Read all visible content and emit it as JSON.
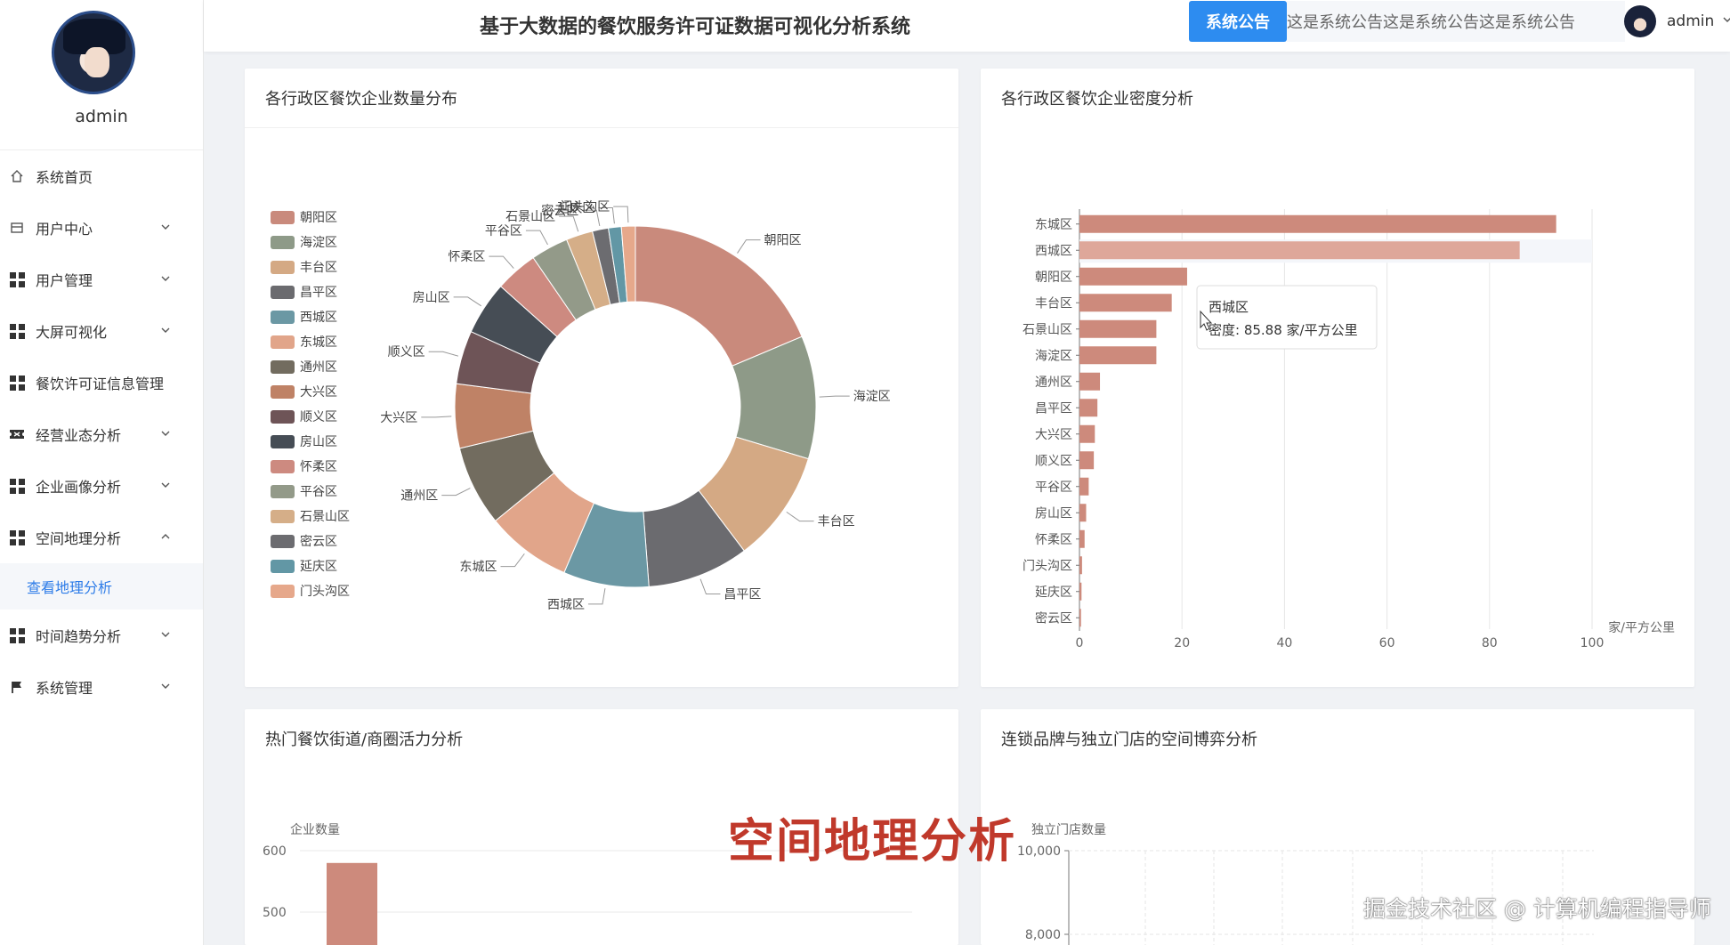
{
  "header": {
    "title": "基于大数据的餐饮服务许可证数据可视化分析系统",
    "notice_button": "系统公告",
    "notice_text": "这是系统公告这是系统公告这是系统公告",
    "user": "admin"
  },
  "sidebar": {
    "username": "admin",
    "items": [
      {
        "label": "系统首页",
        "icon": "home-icon"
      },
      {
        "label": "用户中心",
        "icon": "user-center-icon"
      },
      {
        "label": "用户管理",
        "icon": "grid-icon"
      },
      {
        "label": "大屏可视化",
        "icon": "grid-icon"
      },
      {
        "label": "餐饮许可证信息管理",
        "icon": "grid-icon"
      },
      {
        "label": "经营业态分析",
        "icon": "ticket-icon"
      },
      {
        "label": "企业画像分析",
        "icon": "grid-icon"
      },
      {
        "label": "空间地理分析",
        "icon": "grid-icon"
      },
      {
        "label": "时间趋势分析",
        "icon": "grid-icon"
      },
      {
        "label": "系统管理",
        "icon": "flag-icon"
      }
    ],
    "active_sub": "查看地理分析"
  },
  "cards": {
    "donut_title": "各行政区餐饮企业数量分布",
    "density_title": "各行政区餐饮企业密度分析",
    "street_title": "热门餐饮街道/商圈活力分析",
    "chain_title": "连锁品牌与独立门店的空间博弈分析"
  },
  "overlay": {
    "title": "空间地理分析",
    "watermark": "掘金技术社区 @ 计算机编程指导师"
  },
  "chart_data": [
    {
      "type": "pie",
      "title": "各行政区餐饮企业数量分布",
      "legend_position": "left",
      "categories": [
        "朝阳区",
        "海淀区",
        "丰台区",
        "昌平区",
        "西城区",
        "东城区",
        "通州区",
        "大兴区",
        "顺义区",
        "房山区",
        "怀柔区",
        "平谷区",
        "石景山区",
        "密云区",
        "延庆区",
        "门头沟区"
      ],
      "values": [
        19.5,
        11.5,
        10.5,
        9.5,
        8,
        8,
        7.5,
        6,
        5,
        5,
        4,
        3.5,
        2.5,
        1.5,
        1.2,
        1.3
      ],
      "colors": [
        "#c98a7c",
        "#8e9a88",
        "#d4a984",
        "#6b6b6f",
        "#6b98a4",
        "#e1a58a",
        "#726c5f",
        "#bf8266",
        "#6e5457",
        "#464d55",
        "#cd8a80",
        "#939a89",
        "#d5ae88",
        "#6c6c70",
        "#6297a5",
        "#e6a88b"
      ]
    },
    {
      "type": "bar",
      "title": "各行政区餐饮企业密度分析",
      "orientation": "horizontal",
      "categories": [
        "东城区",
        "西城区",
        "朝阳区",
        "丰台区",
        "石景山区",
        "海淀区",
        "通州区",
        "昌平区",
        "大兴区",
        "顺义区",
        "平谷区",
        "房山区",
        "怀柔区",
        "门头沟区",
        "延庆区",
        "密云区"
      ],
      "values": [
        93,
        85.88,
        21,
        18,
        15,
        15,
        4,
        3.5,
        3,
        2.8,
        1.8,
        1.3,
        1,
        0.5,
        0.4,
        0.3
      ],
      "xlabel": "家/平方公里",
      "xlim": [
        0,
        100
      ],
      "xticks": [
        0,
        20,
        40,
        60,
        80,
        100
      ],
      "tooltip": {
        "title": "西城区",
        "text": "密度: 85.88 家/平方公里"
      }
    },
    {
      "type": "bar",
      "title": "热门餐饮街道/商圈活力分析",
      "ylabel": "企业数量",
      "yticks": [
        600,
        500
      ],
      "categories": [
        ""
      ],
      "values": [
        580
      ]
    },
    {
      "type": "scatter",
      "title": "连锁品牌与独立门店的空间博弈分析",
      "ylabel": "独立门店数量",
      "yticks": [
        "10,000",
        "8,000"
      ],
      "values": []
    }
  ]
}
